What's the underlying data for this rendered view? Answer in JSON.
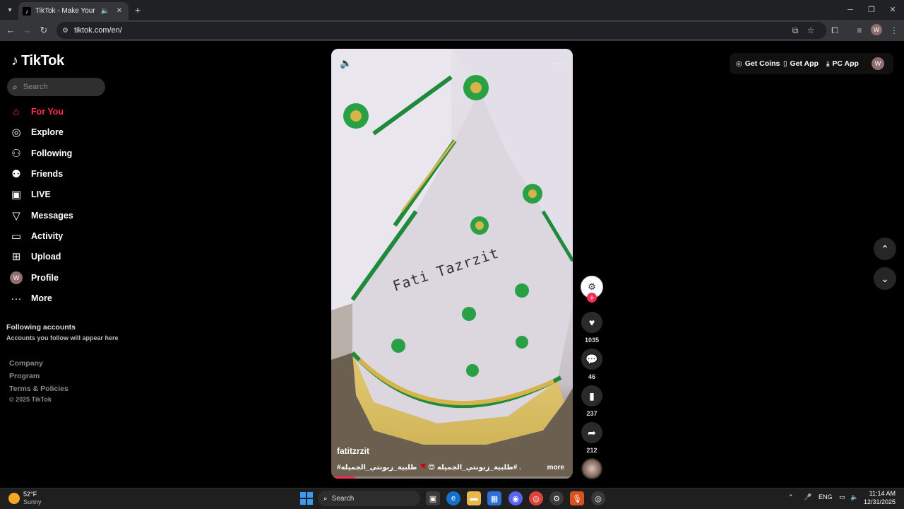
{
  "browser": {
    "tab_title": "TikTok - Make Your Day",
    "url": "tiktok.com/en/",
    "profile_initial": "W"
  },
  "sidebar": {
    "logo_text": "TikTok",
    "search_placeholder": "Search",
    "items": [
      {
        "label": "For You",
        "icon": "home-icon",
        "active": true
      },
      {
        "label": "Explore",
        "icon": "compass-icon"
      },
      {
        "label": "Following",
        "icon": "person-icon"
      },
      {
        "label": "Friends",
        "icon": "friends-icon"
      },
      {
        "label": "LIVE",
        "icon": "live-icon"
      },
      {
        "label": "Messages",
        "icon": "send-icon"
      },
      {
        "label": "Activity",
        "icon": "message-icon"
      },
      {
        "label": "Upload",
        "icon": "plus-box-icon"
      },
      {
        "label": "Profile",
        "icon": "avatar"
      },
      {
        "label": "More",
        "icon": "more-icon"
      }
    ],
    "profile_initial": "W",
    "following_title": "Following accounts",
    "following_sub": "Accounts you follow will appear here",
    "footer_links": [
      "Company",
      "Program",
      "Terms & Policies"
    ],
    "copyright": "© 2025 TikTok"
  },
  "video": {
    "watermark": "Fati Tazrzit",
    "author": "fatitzrzit",
    "caption": "#طلبية_زبونتي_الجميله 😍🌹 طلبية_زبونتي_الجميله# ...",
    "more_label": "more",
    "progress": 0.1
  },
  "actions": {
    "likes": "1035",
    "comments": "46",
    "saves": "237",
    "shares": "212"
  },
  "header": {
    "get_coins": "Get Coins",
    "get_app": "Get App",
    "pc_app": "PC App",
    "avatar_initial": "W"
  },
  "taskbar": {
    "temperature": "52°F",
    "condition": "Sunny",
    "search_label": "Search",
    "language": "ENG",
    "time": "11:14 AM",
    "date": "12/31/2025"
  },
  "colors": {
    "accent": "#fe2c55",
    "background": "#000000"
  }
}
